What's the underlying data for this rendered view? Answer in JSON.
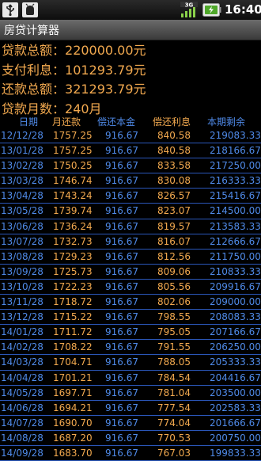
{
  "status_bar": {
    "time": "16:40",
    "icons": [
      "usb-icon",
      "debug-icon",
      "3g-signal-icon",
      "battery-charging-icon"
    ],
    "network_label": "3G"
  },
  "app_title": "房贷计算器",
  "summary": [
    {
      "label": "贷款总额：",
      "value": "220000.00元"
    },
    {
      "label": "支付利息：",
      "value": "101293.79元"
    },
    {
      "label": "还款总额：",
      "value": "321293.79元"
    },
    {
      "label": "贷款月数：",
      "value": "240月"
    }
  ],
  "table": {
    "headers": [
      "日期",
      "月还款",
      "偿还本金",
      "偿还利息",
      "本期剩余"
    ],
    "rows": [
      [
        "12/12/28",
        "1757.25",
        "916.67",
        "840.58",
        "219083.33"
      ],
      [
        "13/01/28",
        "1757.25",
        "916.67",
        "840.58",
        "218166.67"
      ],
      [
        "13/02/28",
        "1750.25",
        "916.67",
        "833.58",
        "217250.00"
      ],
      [
        "13/03/28",
        "1746.74",
        "916.67",
        "830.08",
        "216333.33"
      ],
      [
        "13/04/28",
        "1743.24",
        "916.67",
        "826.57",
        "215416.67"
      ],
      [
        "13/05/28",
        "1739.74",
        "916.67",
        "823.07",
        "214500.00"
      ],
      [
        "13/06/28",
        "1736.24",
        "916.67",
        "819.57",
        "213583.33"
      ],
      [
        "13/07/28",
        "1732.73",
        "916.67",
        "816.07",
        "212666.67"
      ],
      [
        "13/08/28",
        "1729.23",
        "916.67",
        "812.56",
        "211750.00"
      ],
      [
        "13/09/28",
        "1725.73",
        "916.67",
        "809.06",
        "210833.33"
      ],
      [
        "13/10/28",
        "1722.23",
        "916.67",
        "805.56",
        "209916.67"
      ],
      [
        "13/11/28",
        "1718.72",
        "916.67",
        "802.06",
        "209000.00"
      ],
      [
        "13/12/28",
        "1715.22",
        "916.67",
        "798.55",
        "208083.33"
      ],
      [
        "14/01/28",
        "1711.72",
        "916.67",
        "795.05",
        "207166.67"
      ],
      [
        "14/02/28",
        "1708.22",
        "916.67",
        "791.55",
        "206250.00"
      ],
      [
        "14/03/28",
        "1704.71",
        "916.67",
        "788.05",
        "205333.33"
      ],
      [
        "14/04/28",
        "1701.21",
        "916.67",
        "784.54",
        "204416.67"
      ],
      [
        "14/05/28",
        "1697.71",
        "916.67",
        "781.04",
        "203500.00"
      ],
      [
        "14/06/28",
        "1694.21",
        "916.67",
        "777.54",
        "202583.33"
      ],
      [
        "14/07/28",
        "1690.70",
        "916.67",
        "774.04",
        "201666.67"
      ],
      [
        "14/08/28",
        "1687.20",
        "916.67",
        "770.53",
        "200750.00"
      ],
      [
        "14/09/28",
        "1683.70",
        "916.67",
        "767.03",
        "199833.33"
      ]
    ]
  }
}
